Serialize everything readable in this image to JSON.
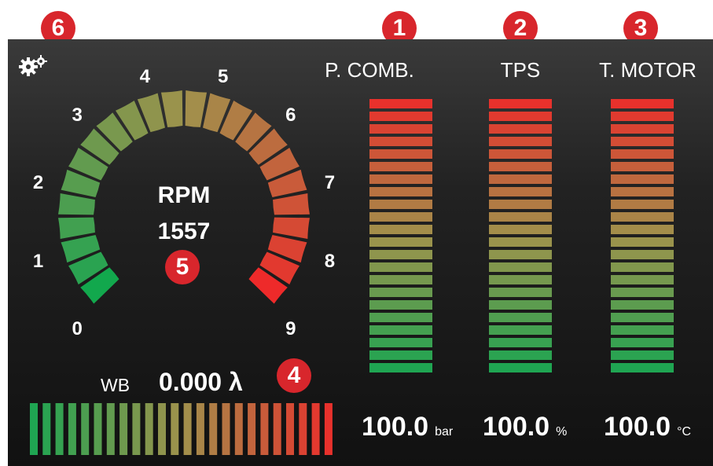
{
  "gauge": {
    "title": "RPM",
    "value": "1557",
    "tick_labels": [
      "0",
      "1",
      "2",
      "3",
      "4",
      "5",
      "6",
      "7",
      "8",
      "9"
    ]
  },
  "wideband": {
    "label": "WB",
    "value": "0.000 λ"
  },
  "columns": [
    {
      "label": "P. COMB.",
      "value": "100.0",
      "unit": "bar"
    },
    {
      "label": "TPS",
      "value": "100.0",
      "unit": "%"
    },
    {
      "label": "T. MOTOR",
      "value": "100.0",
      "unit": "°C"
    }
  ],
  "callouts": [
    "1",
    "2",
    "3",
    "4",
    "5",
    "6"
  ],
  "icons": {
    "settings": "gear-icon"
  },
  "colors": {
    "low": "#1fa552",
    "mid": "#a0924c",
    "high": "#e8312c"
  }
}
